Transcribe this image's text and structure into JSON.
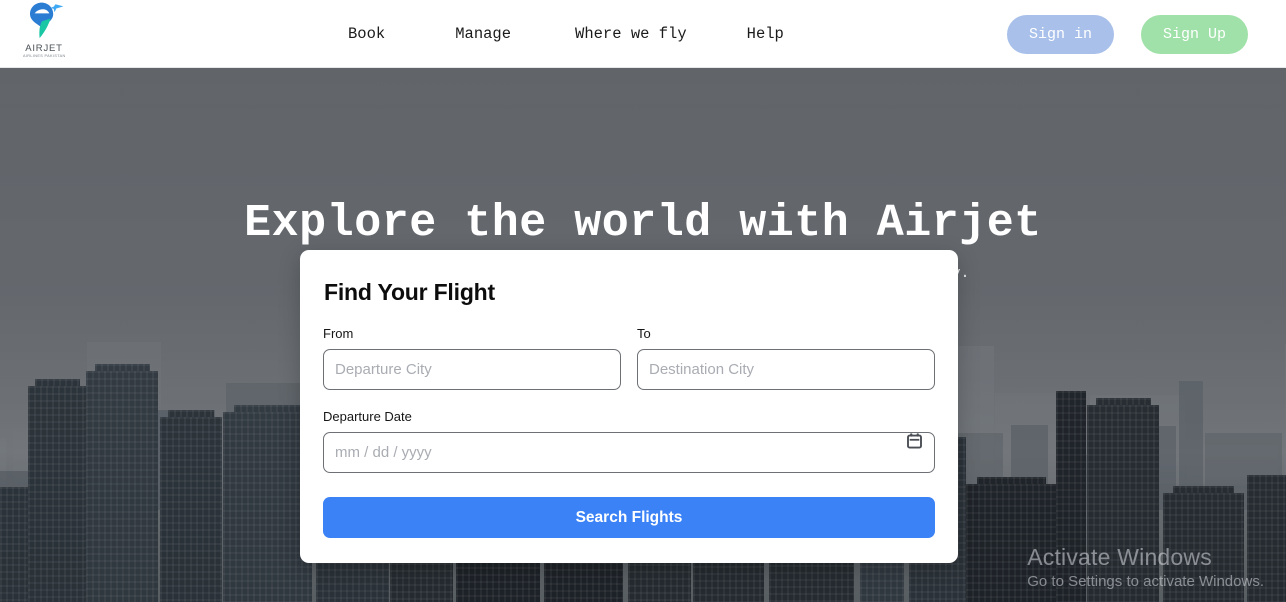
{
  "brand": {
    "name": "AIRJET",
    "tagline": "AIRLINES PAKISTAN",
    "mark_colors": {
      "blue": "#2b7cd3",
      "teal": "#19c7a5",
      "plane": "#3fa9f5"
    }
  },
  "nav": {
    "items": [
      {
        "id": "book",
        "label": "Book"
      },
      {
        "id": "manage",
        "label": "Manage"
      },
      {
        "id": "where-we-fly",
        "label": "Where we fly"
      },
      {
        "id": "help",
        "label": "Help"
      }
    ]
  },
  "auth": {
    "sign_in_label": "Sign in",
    "sign_up_label": "Sign Up",
    "sign_in_color": "#a8c0ea",
    "sign_up_color": "#9fe1a8"
  },
  "hero": {
    "title": "Explore the world with Airjet",
    "subtitle": "Discover our wide range of destinations and plan your next adventure today."
  },
  "search_card": {
    "title": "Find Your Flight",
    "from": {
      "label": "From",
      "value": "",
      "placeholder": "Departure City"
    },
    "to": {
      "label": "To",
      "value": "",
      "placeholder": "Destination City"
    },
    "departure_date": {
      "label": "Departure Date",
      "value": "",
      "placeholder": "mm / dd / yyyy",
      "icon": "calendar-icon"
    },
    "submit_label": "Search Flights",
    "submit_color": "#3b82f6"
  },
  "watermark": {
    "line1": "Activate Windows",
    "line2": "Go to Settings to activate Windows."
  }
}
